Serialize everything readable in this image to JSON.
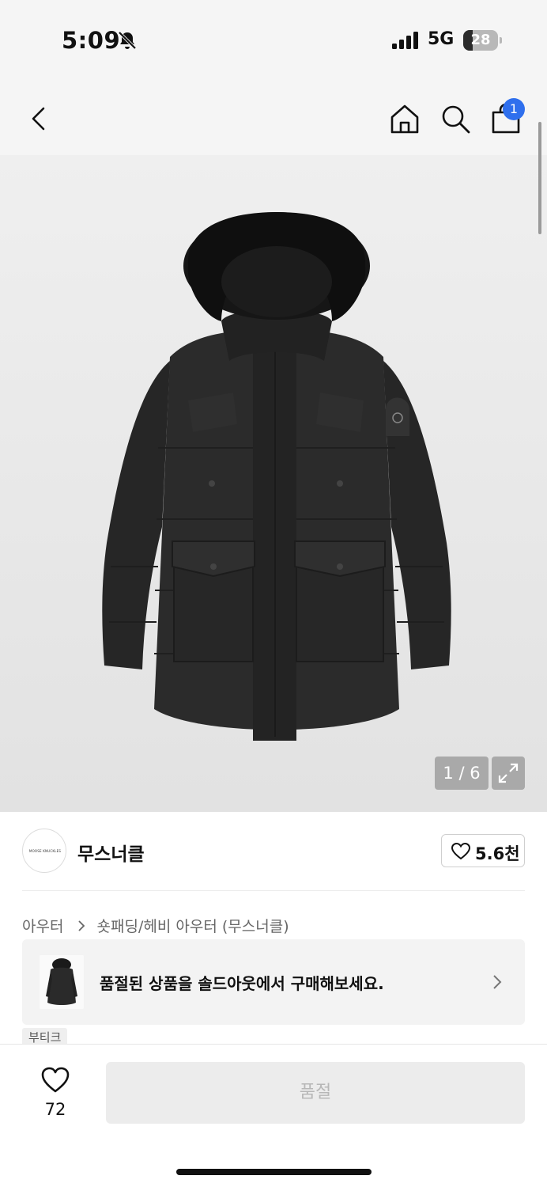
{
  "status_bar": {
    "time": "5:09",
    "network": "5G",
    "battery_level": "28",
    "battery_fraction": 0.28
  },
  "nav": {
    "icons": [
      "back-icon",
      "home-icon",
      "search-icon",
      "shopping-bag-icon"
    ],
    "cart_count": "1"
  },
  "gallery": {
    "counter": "1 / 6",
    "current": 1,
    "total": 6
  },
  "brand": {
    "name": "무스너클",
    "logo_text": "MOOSE KNUCKLES",
    "like_count": "5.6천"
  },
  "breadcrumb": {
    "items": [
      "아우터",
      "숏패딩/헤비 아우터 (무스너클)"
    ]
  },
  "soldout_banner": {
    "text": "품절된 상품을 솔드아웃에서 구매해보세요."
  },
  "tag": {
    "label": "부티크"
  },
  "bottom_bar": {
    "wish_count": "72",
    "buy_button_label": "품절"
  },
  "colors": {
    "accent": "#2f6fed",
    "nav_background": "#f5f5f5",
    "disabled_button": "#ececec"
  }
}
